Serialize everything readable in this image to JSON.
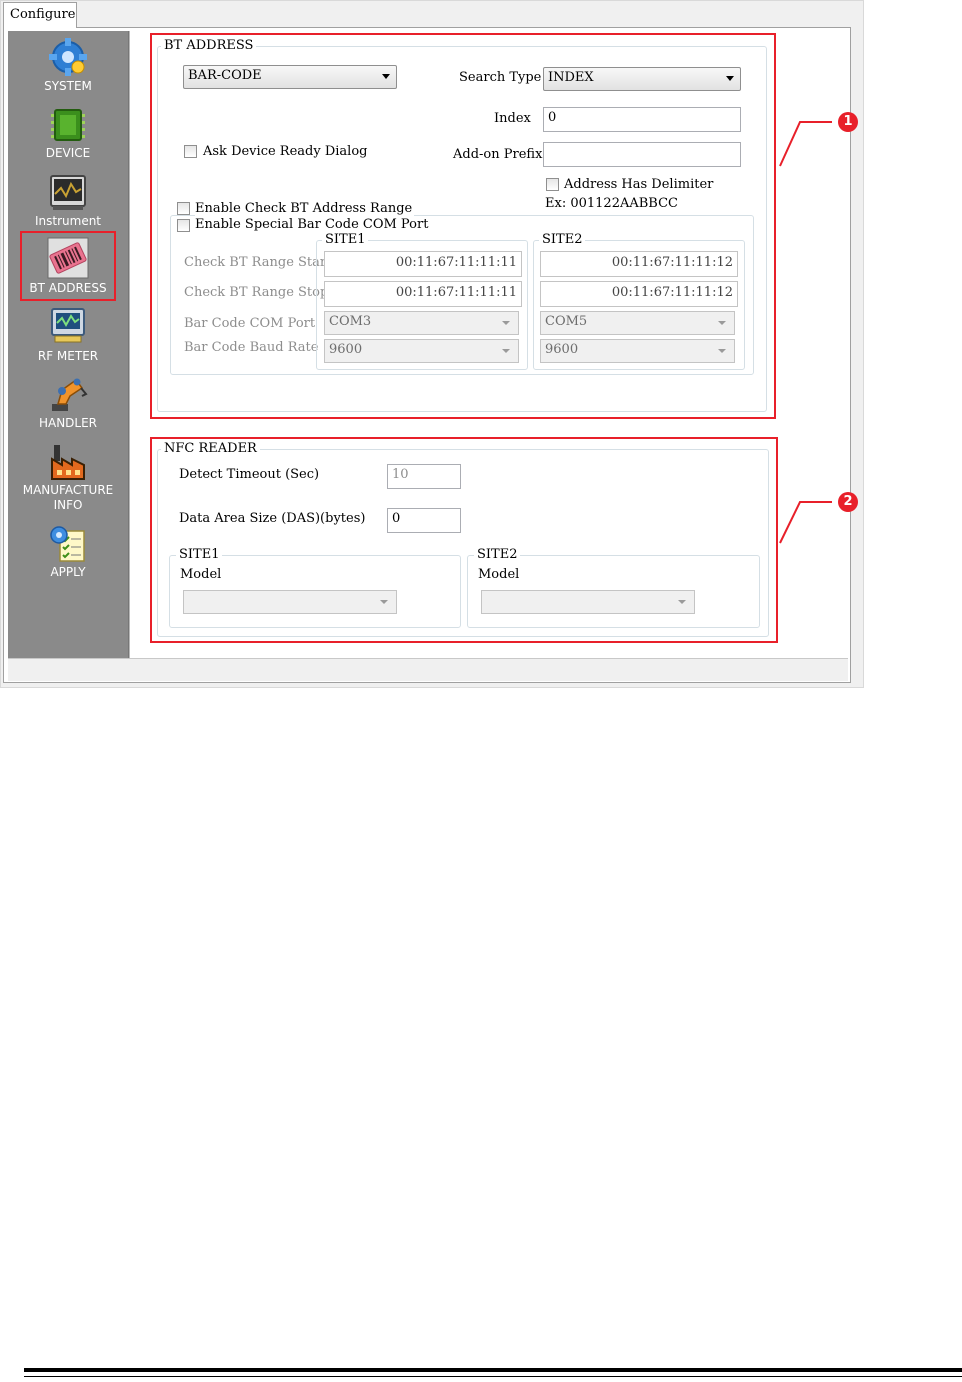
{
  "tab": {
    "label": "Configure"
  },
  "sidebar": {
    "items": [
      {
        "label": "SYSTEM",
        "icon": "gear-icon"
      },
      {
        "label": "DEVICE",
        "icon": "chip-icon"
      },
      {
        "label": "Instrument",
        "icon": "oscilloscope-icon"
      },
      {
        "label": "BT ADDRESS",
        "icon": "barcode-icon",
        "selected": true
      },
      {
        "label": "RF METER",
        "icon": "rf-meter-icon"
      },
      {
        "label": "HANDLER",
        "icon": "robot-arm-icon"
      },
      {
        "label": "MANUFACTURE INFO",
        "label_line1": "MANUFACTURE",
        "label_line2": "INFO",
        "icon": "factory-icon"
      },
      {
        "label": "APPLY",
        "icon": "apply-icon"
      }
    ]
  },
  "bt_address": {
    "title": "BT ADDRESS",
    "source_select": "BAR-CODE",
    "search_type_label": "Search Type",
    "search_type_value": "INDEX",
    "index_label": "Index",
    "index_value": "0",
    "ask_device_ready_label": "Ask Device Ready Dialog",
    "addon_prefix_label": "Add-on Prefix",
    "addon_prefix_value": "",
    "address_has_delimiter_label": "Address Has Delimiter",
    "example_text": "Ex: 001122AABBCC",
    "enable_check_range_label": "Enable Check BT Address Range",
    "enable_special_com_label": "Enable Special Bar Code COM Port",
    "row_labels": {
      "range_start": "Check BT Range Start",
      "range_stop": "Check BT Range Stop",
      "com_port": "Bar Code COM Port",
      "baud_rate": "Bar Code Baud Rate"
    },
    "site1": {
      "title": "SITE1",
      "range_start": "00:11:67:11:11:11",
      "range_stop": "00:11:67:11:11:11",
      "com_port": "COM3",
      "baud_rate": "9600"
    },
    "site2": {
      "title": "SITE2",
      "range_start": "00:11:67:11:11:12",
      "range_stop": "00:11:67:11:11:12",
      "com_port": "COM5",
      "baud_rate": "9600"
    }
  },
  "nfc_reader": {
    "title": "NFC READER",
    "detect_timeout_label": "Detect Timeout (Sec)",
    "detect_timeout_value": "10",
    "data_area_size_label": "Data Area Size (DAS)(bytes)",
    "data_area_size_value": "0",
    "site1": {
      "title": "SITE1",
      "model_label": "Model",
      "model_value": ""
    },
    "site2": {
      "title": "SITE2",
      "model_label": "Model",
      "model_value": ""
    }
  },
  "callouts": {
    "one": "1",
    "two": "2"
  },
  "colors": {
    "highlight": "#e8202a",
    "sidebar": "#8a8a8a"
  }
}
